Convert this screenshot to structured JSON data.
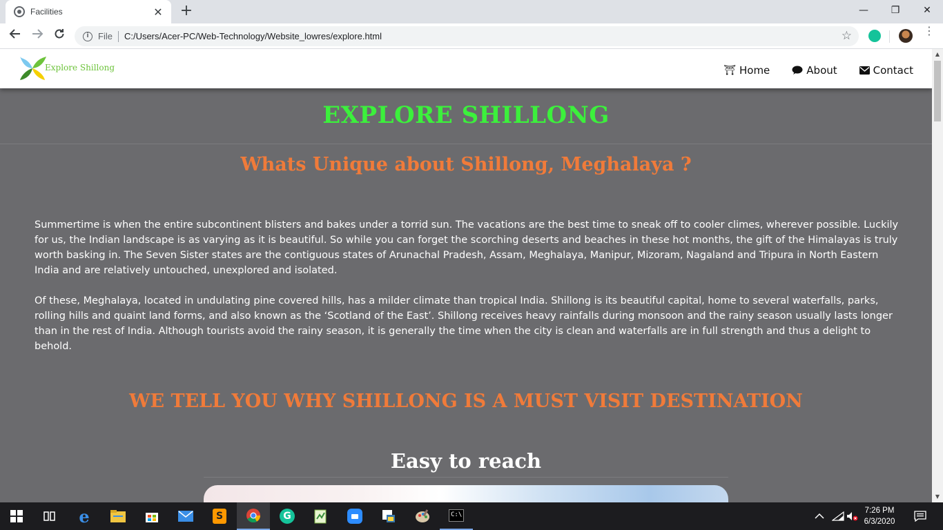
{
  "browser": {
    "tab_title": "Facilities",
    "tab_close": "✕",
    "new_tab": "+",
    "file_label": "File",
    "url": "C:/Users/Acer-PC/Web-Technology/Website_lowres/explore.html",
    "window_controls": {
      "minimize": "—",
      "restore": "❐",
      "close": "✕"
    }
  },
  "site_nav": {
    "logo_text": "Explore Shillong",
    "items": [
      {
        "label": "Home",
        "icon": "torii-gate-icon",
        "glyph": "⛩"
      },
      {
        "label": "About",
        "icon": "comment-icon",
        "glyph": "💬"
      },
      {
        "label": "Contact",
        "icon": "envelope-icon",
        "glyph": "✉"
      }
    ]
  },
  "content": {
    "hero_title": "EXPLORE SHILLONG",
    "question_heading": "Whats Unique about Shillong, Meghalaya ?",
    "paragraph_1": "Summertime is when the entire subcontinent blisters and bakes under a torrid sun. The vacations are the best time to sneak off to cooler climes, wherever possible. Luckily for us, the Indian landscape is as varying as it is beautiful. So while you can forget the scorching deserts and beaches in these hot months, the gift of the Himalayas is truly worth basking in. The Seven Sister states are the contiguous states of Arunachal Pradesh, Assam, Meghalaya, Manipur, Mizoram, Nagaland and Tripura in North Eastern India and are relatively untouched, unexplored and isolated.",
    "paragraph_2": "Of these, Meghalaya, located in undulating pine covered hills, has a milder climate than tropical India. Shillong is its beautiful capital, home to several waterfalls, parks, rolling hills and quaint land forms, and also known as the ‘Scotland of the East’. Shillong receives heavy rainfalls during monsoon and the rainy season usually lasts longer than in the rest of India. Although tourists avoid the rainy season, it is generally the time when the city is clean and waterfalls are in full strength and thus a delight to behold.",
    "why_heading": "WE TELL YOU WHY SHILLONG IS A MUST VISIT DESTINATION",
    "sub_heading": "Easy to reach"
  },
  "colors": {
    "hero_title": "#3cf03c",
    "headings": "#f07b3a",
    "page_bg": "#6b6b6e",
    "logo_text": "#6dc33b"
  },
  "taskbar": {
    "apps": [
      "windows-start-icon",
      "task-view-icon",
      "edge-icon",
      "file-explorer-icon",
      "store-icon",
      "mail-icon",
      "sublime-text-icon",
      "chrome-icon",
      "grammarly-icon",
      "notepad-plus-icon",
      "zoom-icon",
      "python-icon",
      "paint-icon",
      "terminal-icon"
    ],
    "time": "7:26 PM",
    "date": "6/3/2020"
  }
}
